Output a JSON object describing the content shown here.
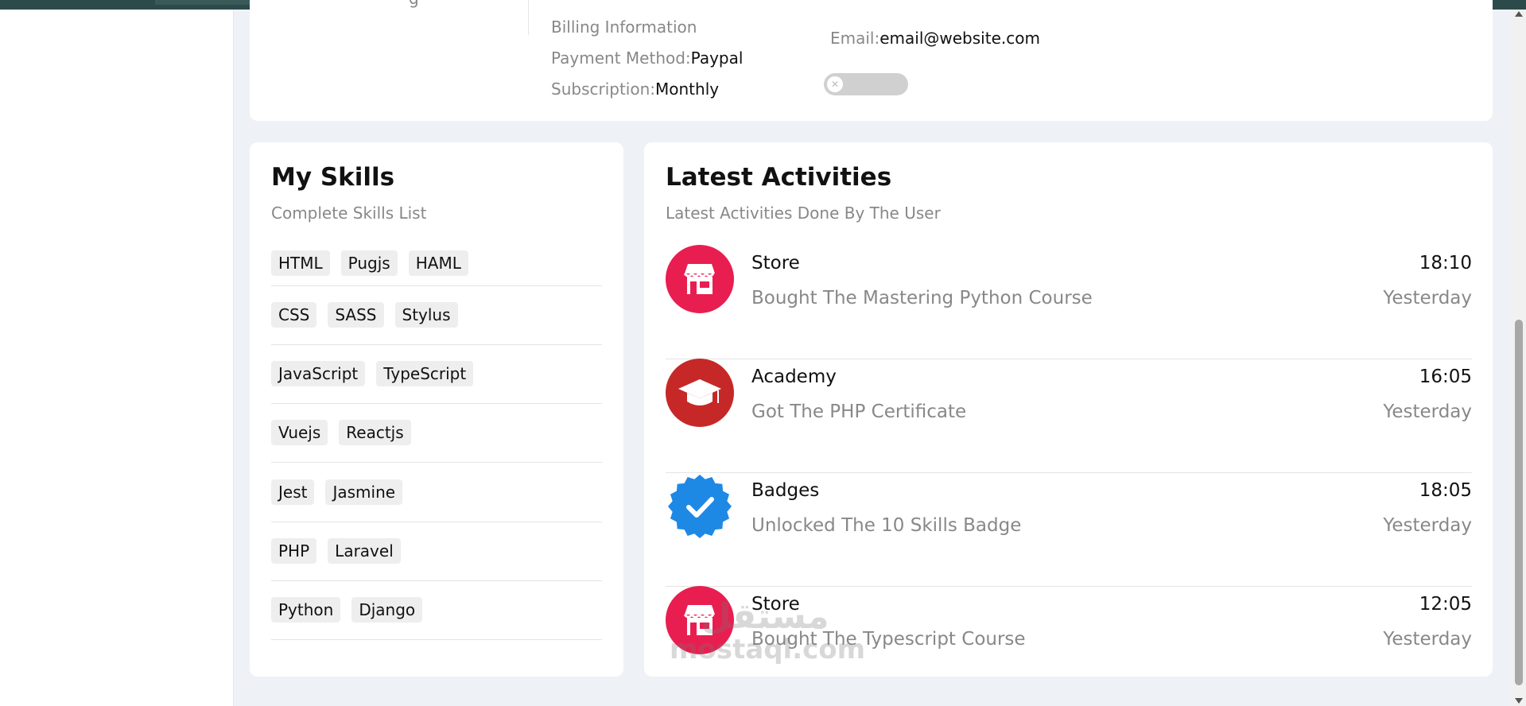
{
  "billing": {
    "heading": "Billing Information",
    "payment_label": "Payment Method:",
    "payment_value": "Paypal",
    "subscription_label": "Subscription:",
    "subscription_value": "Monthly",
    "email_label": "Email:",
    "email_value": "email@website.com",
    "cut_off_text": "g"
  },
  "skills": {
    "title": "My Skills",
    "subtitle": "Complete Skills List",
    "rows": [
      [
        "HTML",
        "Pugjs",
        "HAML"
      ],
      [
        "CSS",
        "SASS",
        "Stylus"
      ],
      [
        "JavaScript",
        "TypeScript"
      ],
      [
        "Vuejs",
        "Reactjs"
      ],
      [
        "Jest",
        "Jasmine"
      ],
      [
        "PHP",
        "Laravel"
      ],
      [
        "Python",
        "Django"
      ]
    ]
  },
  "activities": {
    "title": "Latest Activities",
    "subtitle": "Latest Activities Done By The User",
    "items": [
      {
        "name": "Store",
        "desc": "Bought The Mastering Python Course",
        "time": "18:10",
        "day": "Yesterday",
        "icon": "store-icon"
      },
      {
        "name": "Academy",
        "desc": "Got The PHP Certificate",
        "time": "16:05",
        "day": "Yesterday",
        "icon": "graduation-cap-icon"
      },
      {
        "name": "Badges",
        "desc": "Unlocked The 10 Skills Badge",
        "time": "18:05",
        "day": "Yesterday",
        "icon": "verified-badge-icon"
      },
      {
        "name": "Store",
        "desc": "Bought The Typescript Course",
        "time": "12:05",
        "day": "Yesterday",
        "icon": "store-icon"
      }
    ]
  },
  "watermark": {
    "arabic": "مستقل",
    "latin": "mostaql.com"
  },
  "colors": {
    "store": "#e91e50",
    "academy": "#c62828",
    "badge": "#1e88e5",
    "background": "#eef1f5"
  }
}
